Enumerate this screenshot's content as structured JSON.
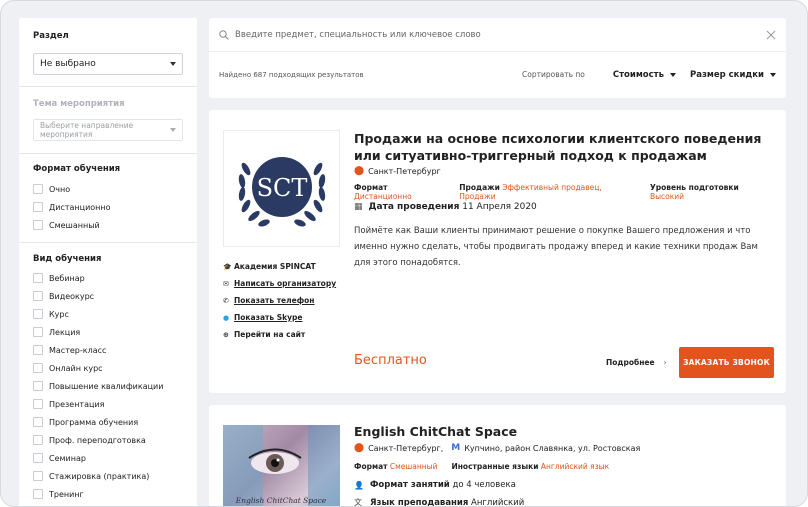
{
  "sidebar": {
    "section_label": "Раздел",
    "section_value": "Не выбрано",
    "topic_label": "Тема мероприятия",
    "topic_placeholder": "Выберите направление мероприятия",
    "format_label": "Формат обучения",
    "format_options": [
      "Очно",
      "Дистанционно",
      "Смешанный"
    ],
    "type_label": "Вид обучения",
    "type_options": [
      "Вебинар",
      "Видеокурс",
      "Курс",
      "Лекция",
      "Мастер-класс",
      "Онлайн курс",
      "Повышение квалификации",
      "Презентация",
      "Программа обучения",
      "Проф. переподготовка",
      "Семинар",
      "Стажировка (практика)",
      "Тренинг"
    ]
  },
  "search": {
    "placeholder": "Введите предмет, специальность или ключевое слово",
    "results_text": "Найдено 687 подходящих результатов",
    "sort_label": "Сортировать по",
    "sort_cost": "Стоимость",
    "sort_discount": "Размер скидки"
  },
  "card1": {
    "logo_text": "SCT",
    "title": "Продажи на основе психологии клиентского поведения или ситуативно-триггерный подход к продажам",
    "city": "Санкт-Петербург",
    "tags": [
      {
        "label": "Формат",
        "value": "Дистанционно"
      },
      {
        "label": "Продажи",
        "value": "Эффективный продавец, Продажи"
      },
      {
        "label": "Уровень подготовки",
        "value": "Высокий"
      }
    ],
    "date_label": "Дата проведения",
    "date_value": "11 Апреля 2020",
    "description": "Поймёте как Ваши клиенты принимают решение о покупке Вашего предложения и что именно нужно сделать, чтобы продвигать продажу вперед и какие техники продаж Вам для этого понадобятся.",
    "org_name": "Академия SPINCAT",
    "links": [
      "Написать организатору",
      "Показать телефон",
      "Показать Skype",
      "Перейти на сайт"
    ],
    "price": "Бесплатно",
    "more": "Подробнее",
    "call_button": "ЗАКАЗАТЬ ЗВОНОК"
  },
  "card2": {
    "image_caption": "English ChitChat Space",
    "title": "English ChitChat Space",
    "city": "Санкт-Петербург,",
    "metro_address": "Купчино, район Славянка, ул. Ростовская",
    "tags": [
      {
        "label": "Формат",
        "value": "Смешанный"
      },
      {
        "label": "Иностранные языки",
        "value": "Английский язык"
      }
    ],
    "class_format_label": "Формат занятий",
    "class_format_value": "до 4 человека",
    "teach_lang_label": "Язык преподавания",
    "teach_lang_value": "Английский"
  },
  "colors": {
    "accent": "#e2541c",
    "logo_navy": "#2b3a63",
    "metro": "#3b6fd6"
  }
}
